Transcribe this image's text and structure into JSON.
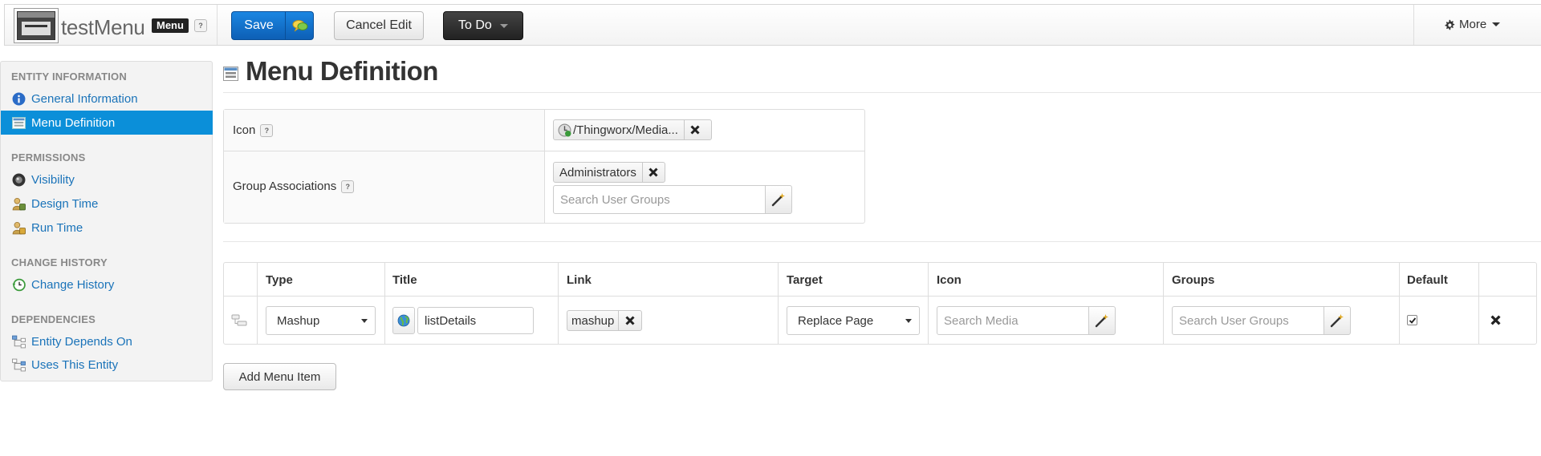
{
  "header": {
    "entity_name": "testMenu",
    "type_badge": "Menu",
    "help_badge": "?",
    "save_label": "Save",
    "cancel_label": "Cancel Edit",
    "todo_label": "To Do",
    "more_label": "More"
  },
  "sidebar": {
    "sections": [
      {
        "heading": "ENTITY INFORMATION",
        "items": [
          {
            "label": "General Information",
            "icon": "info-icon"
          },
          {
            "label": "Menu Definition",
            "icon": "menu-icon",
            "active": true
          }
        ]
      },
      {
        "heading": "PERMISSIONS",
        "items": [
          {
            "label": "Visibility",
            "icon": "visibility-icon"
          },
          {
            "label": "Design Time",
            "icon": "design-time-icon"
          },
          {
            "label": "Run Time",
            "icon": "run-time-icon"
          }
        ]
      },
      {
        "heading": "CHANGE HISTORY",
        "items": [
          {
            "label": "Change History",
            "icon": "history-icon"
          }
        ]
      },
      {
        "heading": "DEPENDENCIES",
        "items": [
          {
            "label": "Entity Depends On",
            "icon": "dependency-icon"
          },
          {
            "label": "Uses This Entity",
            "icon": "dependency-icon"
          }
        ]
      }
    ]
  },
  "main": {
    "title": "Menu Definition",
    "definition": {
      "icon_label": "Icon",
      "icon_value": "/Thingworx/Media...",
      "group_label": "Group Associations",
      "group_tag": "Administrators",
      "group_search_placeholder": "Search User Groups"
    },
    "items_table": {
      "columns": [
        "Type",
        "Title",
        "Link",
        "Target",
        "Icon",
        "Groups",
        "Default"
      ],
      "rows": [
        {
          "type": "Mashup",
          "title": "listDetails",
          "link": "mashup",
          "target": "Replace Page",
          "icon_placeholder": "Search Media",
          "groups_placeholder": "Search User Groups",
          "default": true
        }
      ]
    },
    "add_item_label": "Add Menu Item"
  },
  "colors": {
    "accent": "#0b8fd9",
    "save_button": "#1b86e2",
    "todo_button": "#333333",
    "link": "#1a73b9"
  }
}
